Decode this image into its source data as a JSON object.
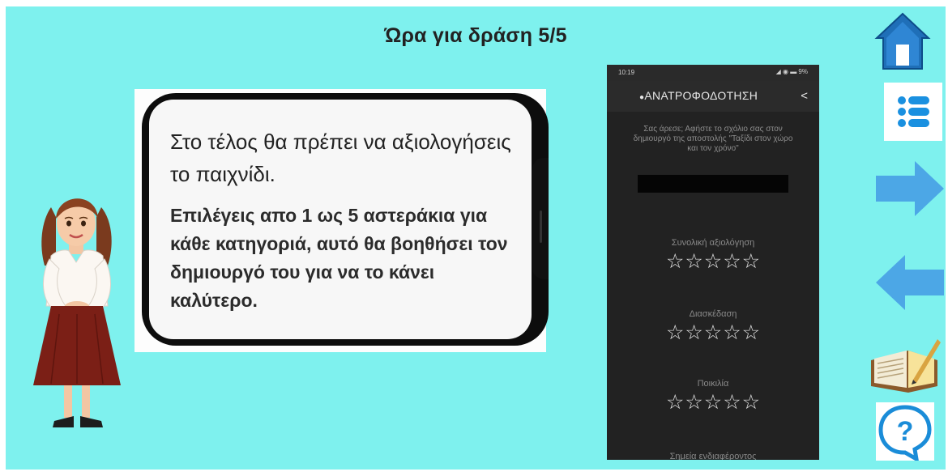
{
  "header": {
    "title": "Ώρα για δράση 5/5"
  },
  "card": {
    "heading": "Στο τέλος θα πρέπει να αξιολογήσεις το παιχνίδι.",
    "body": "Επιλέγεις απο 1 ως 5 αστεράκια για κάθε κατηγοριά, αυτό θα βοηθήσει τον δημιουργό του για να το κάνει καλύτερο."
  },
  "phone_mock": {
    "status_time": "10:19",
    "status_icons": "◢ ◉ ▬ 9%",
    "header_title": "ΑΝΑΤΡΟΦΟΔΟΤΗΣΗ",
    "intro": "Σας άρεσε; Αφήστε το σχόλιο σας στον δημιουργό της αποστολής \"Ταξίδι στον χώρο και τον χρόνο\"",
    "ratings": [
      {
        "label": "Συνολική αξιολόγηση",
        "stars": 0,
        "max": 5
      },
      {
        "label": "Διασκέδαση",
        "stars": 0,
        "max": 5
      },
      {
        "label": "Ποικιλία",
        "stars": 0,
        "max": 5
      }
    ],
    "footer": "Σημεία ενδιαφέροντος"
  },
  "nav": {
    "icons": [
      "home-icon",
      "menu-list-icon",
      "next-arrow-icon",
      "back-arrow-icon",
      "notebook-icon",
      "help-icon"
    ],
    "colors": {
      "home": "#1f6fb8",
      "menu": "#1a90e0",
      "arrows": "#4ca7e6",
      "help": "#1a8cd8"
    }
  },
  "colors": {
    "background": "#7ef1ee",
    "mock_bg": "#222222"
  }
}
